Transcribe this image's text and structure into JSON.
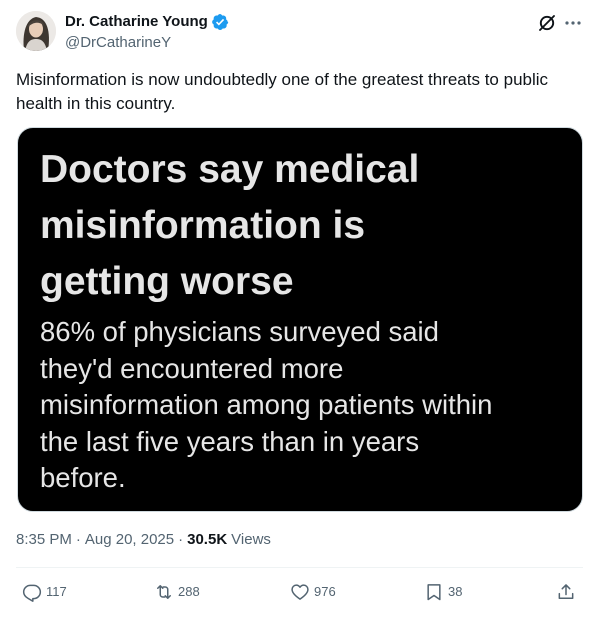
{
  "author": {
    "display_name": "Dr. Catharine Young",
    "handle": "@DrCatharineY",
    "verified": true
  },
  "icons": {
    "avatar": "profile-photo",
    "verified": "verified-badge-icon",
    "grok": "grok-icon",
    "more": "more-icon",
    "reply": "reply-icon",
    "repost": "repost-icon",
    "like": "like-icon",
    "bookmark": "bookmark-icon",
    "share": "share-icon"
  },
  "colors": {
    "accent": "#1d9bf0",
    "text_primary": "#0f1419",
    "text_secondary": "#536471",
    "media_background": "#000000",
    "media_text": "#e6e6e6"
  },
  "tweet": {
    "text_line1": "Misinformation is now undoubtedly one of the greatest threats to public",
    "text_line2": "health in this country."
  },
  "media": {
    "headline_line1": "Doctors say medical",
    "headline_line2": "misinformation is",
    "headline_line3": "getting worse",
    "body_line1": "86% of physicians surveyed said",
    "body_line2": "they'd encountered more",
    "body_line3": "misinformation among patients within",
    "body_line4": "the last five years than in years",
    "body_line5": "before."
  },
  "meta": {
    "time": "8:35 PM",
    "separator": "·",
    "date": "Aug 20, 2025",
    "separator2": "·",
    "views_count": "30.5K",
    "views_label": "Views"
  },
  "actions": {
    "replies": "117",
    "reposts": "288",
    "likes": "976",
    "bookmarks": "38"
  }
}
